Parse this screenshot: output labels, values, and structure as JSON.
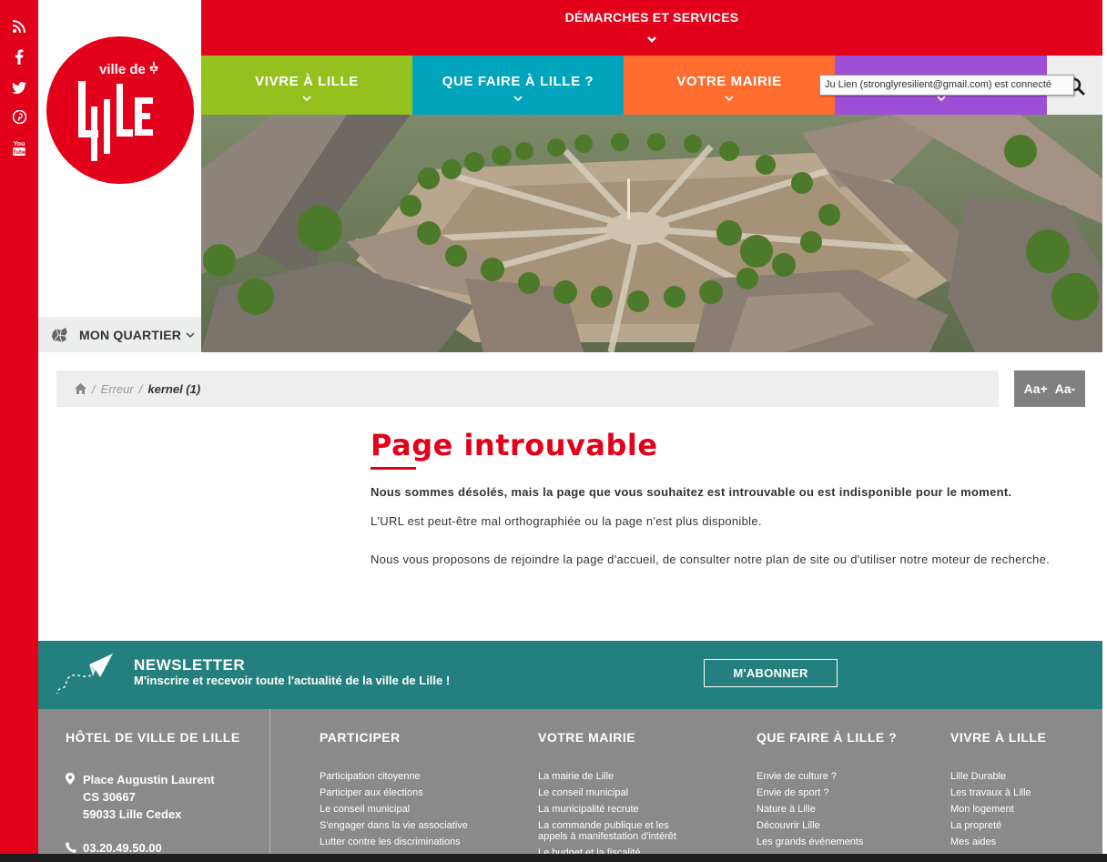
{
  "social": {
    "icons": [
      "rss-icon",
      "facebook-icon",
      "twitter-icon",
      "pinterest-icon",
      "youtube-icon"
    ]
  },
  "logo": {
    "villede": "ville de",
    "name": "Lille"
  },
  "quartier": {
    "label": "MON QUARTIER"
  },
  "top_banner": {
    "label": "DÉMARCHES ET SERVICES"
  },
  "nav": [
    {
      "label": "VIVRE À LILLE",
      "color": "#95c11f"
    },
    {
      "label": "QUE FAIRE À LILLE ?",
      "color": "#00a5bd"
    },
    {
      "label": "VOTRE MAIRIE",
      "color": "#ff6d2e"
    },
    {
      "label": "",
      "color": "#9e4fd7"
    }
  ],
  "tooltip": {
    "text": "Ju Lien (stronglyresilient@gmail.com) est connecté"
  },
  "breadcrumb": {
    "sep": "/",
    "erreur": "Erreur",
    "current": "kernel (1)"
  },
  "fontsize": {
    "increase": "Aa+",
    "decrease": "Aa-"
  },
  "content": {
    "title": "Page introuvable",
    "bold_message": "Nous sommes désolés, mais la page que vous souhaitez est introuvable ou est indisponible pour le moment.",
    "message_1": "L'URL est peut-être mal orthographiée ou la page n'est plus disponible.",
    "message_2": "Nous vous proposons de rejoindre la page d'accueil, de consulter notre plan de site ou d'utiliser notre moteur de recherche."
  },
  "newsletter": {
    "title": "NEWSLETTER",
    "subtitle": "M'inscrire et recevoir toute l'actualité de la ville de Lille !",
    "button": "M'ABONNER"
  },
  "footer": {
    "hotel": {
      "title": "HÔTEL DE VILLE DE LILLE",
      "address_1": "Place Augustin Laurent",
      "address_2": "CS 30667",
      "address_3": "59033 Lille Cedex",
      "phone": "03.20.49.50.00"
    },
    "participer": {
      "title": "PARTICIPER",
      "links": [
        "Participation citoyenne",
        "Participer aux élections",
        "Le conseil municipal",
        "S'engager dans la vie associative",
        "Lutter contre les discriminations"
      ]
    },
    "votre_mairie": {
      "title": "VOTRE MAIRIE",
      "links": [
        "La mairie de Lille",
        "Le conseil municipal",
        "La municipalité recrute",
        "La commande publique et les appels à manifestation d'intérêt",
        "Le budget et la fiscalité"
      ]
    },
    "que_faire": {
      "title": "QUE FAIRE À LILLE ?",
      "links": [
        "Envie de culture ?",
        "Envie de sport ?",
        "Nature à Lille",
        "Découvrir Lille",
        "Les grands événements"
      ]
    },
    "vivre": {
      "title": "VIVRE À LILLE",
      "links": [
        "Lille Durable",
        "Les travaux à Lille",
        "Mon logement",
        "La propreté",
        "Mes aides"
      ]
    }
  },
  "colors": {
    "brand_red": "#e2001a",
    "newsletter_teal": "#24807e",
    "footer_grey": "#8a8a8a"
  }
}
